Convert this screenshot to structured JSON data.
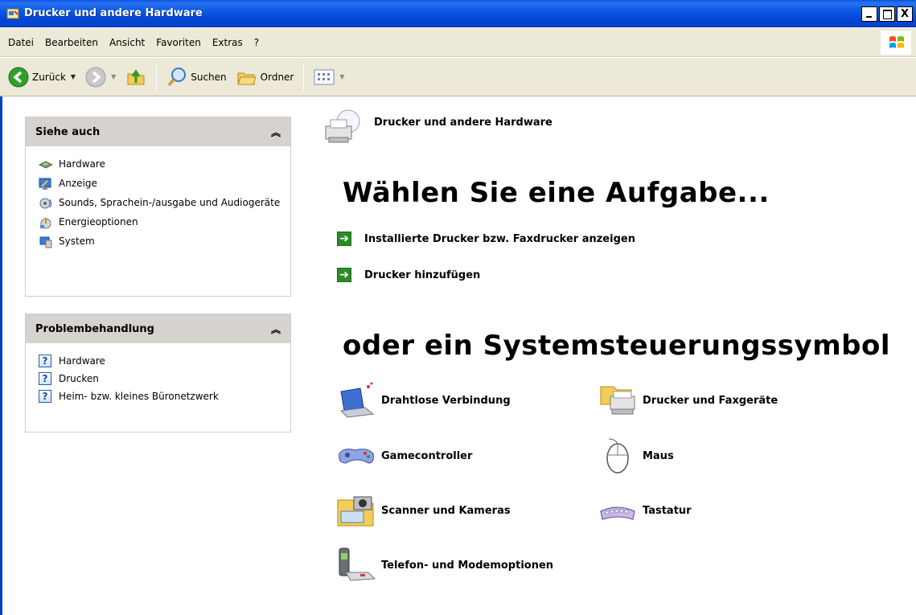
{
  "window": {
    "title": "Drucker und andere Hardware",
    "close_glyph": "X"
  },
  "menu": [
    "Datei",
    "Bearbeiten",
    "Ansicht",
    "Favoriten",
    "Extras",
    "?"
  ],
  "toolbar": {
    "back_label": "Zurück",
    "search_label": "Suchen",
    "folders_label": "Ordner"
  },
  "see_also": {
    "title": "Siehe auch",
    "items": [
      {
        "label": "Hardware",
        "icon": "hardware-icon"
      },
      {
        "label": "Anzeige",
        "icon": "display-icon"
      },
      {
        "label": "Sounds, Sprachein-/ausgabe und Audiogeräte",
        "icon": "sound-icon"
      },
      {
        "label": "Energieoptionen",
        "icon": "power-icon"
      },
      {
        "label": "System",
        "icon": "system-icon"
      }
    ]
  },
  "troubleshoot": {
    "title": "Problembehandlung",
    "items": [
      {
        "label": "Hardware",
        "icon": "help-icon"
      },
      {
        "label": "Drucken",
        "icon": "help-icon"
      },
      {
        "label": "Heim- bzw. kleines Büronetzwerk",
        "icon": "help-icon"
      }
    ]
  },
  "main": {
    "category_title": "Drucker und andere Hardware",
    "task_heading": "Wählen Sie eine Aufgabe...",
    "tasks": [
      "Installierte Drucker bzw. Faxdrucker anzeigen",
      "Drucker hinzufügen"
    ],
    "icon_heading": "oder ein Systemsteuerungssymbol",
    "control_panel_items": [
      {
        "label": "Drahtlose Verbindung",
        "icon": "wireless-laptop-icon"
      },
      {
        "label": "Drucker und Faxgeräte",
        "icon": "printer-fax-icon"
      },
      {
        "label": "Gamecontroller",
        "icon": "gamepad-icon"
      },
      {
        "label": "Maus",
        "icon": "mouse-icon"
      },
      {
        "label": "Scanner und Kameras",
        "icon": "scanner-camera-icon"
      },
      {
        "label": "Tastatur",
        "icon": "keyboard-icon"
      },
      {
        "label": "Telefon- und Modemoptionen",
        "icon": "phone-modem-icon"
      }
    ]
  },
  "colors": {
    "titlebar": "#0a54e4",
    "chrome": "#ece9d8",
    "panel_header": "#d6d3ce",
    "task_arrow": "#2e8b28"
  }
}
